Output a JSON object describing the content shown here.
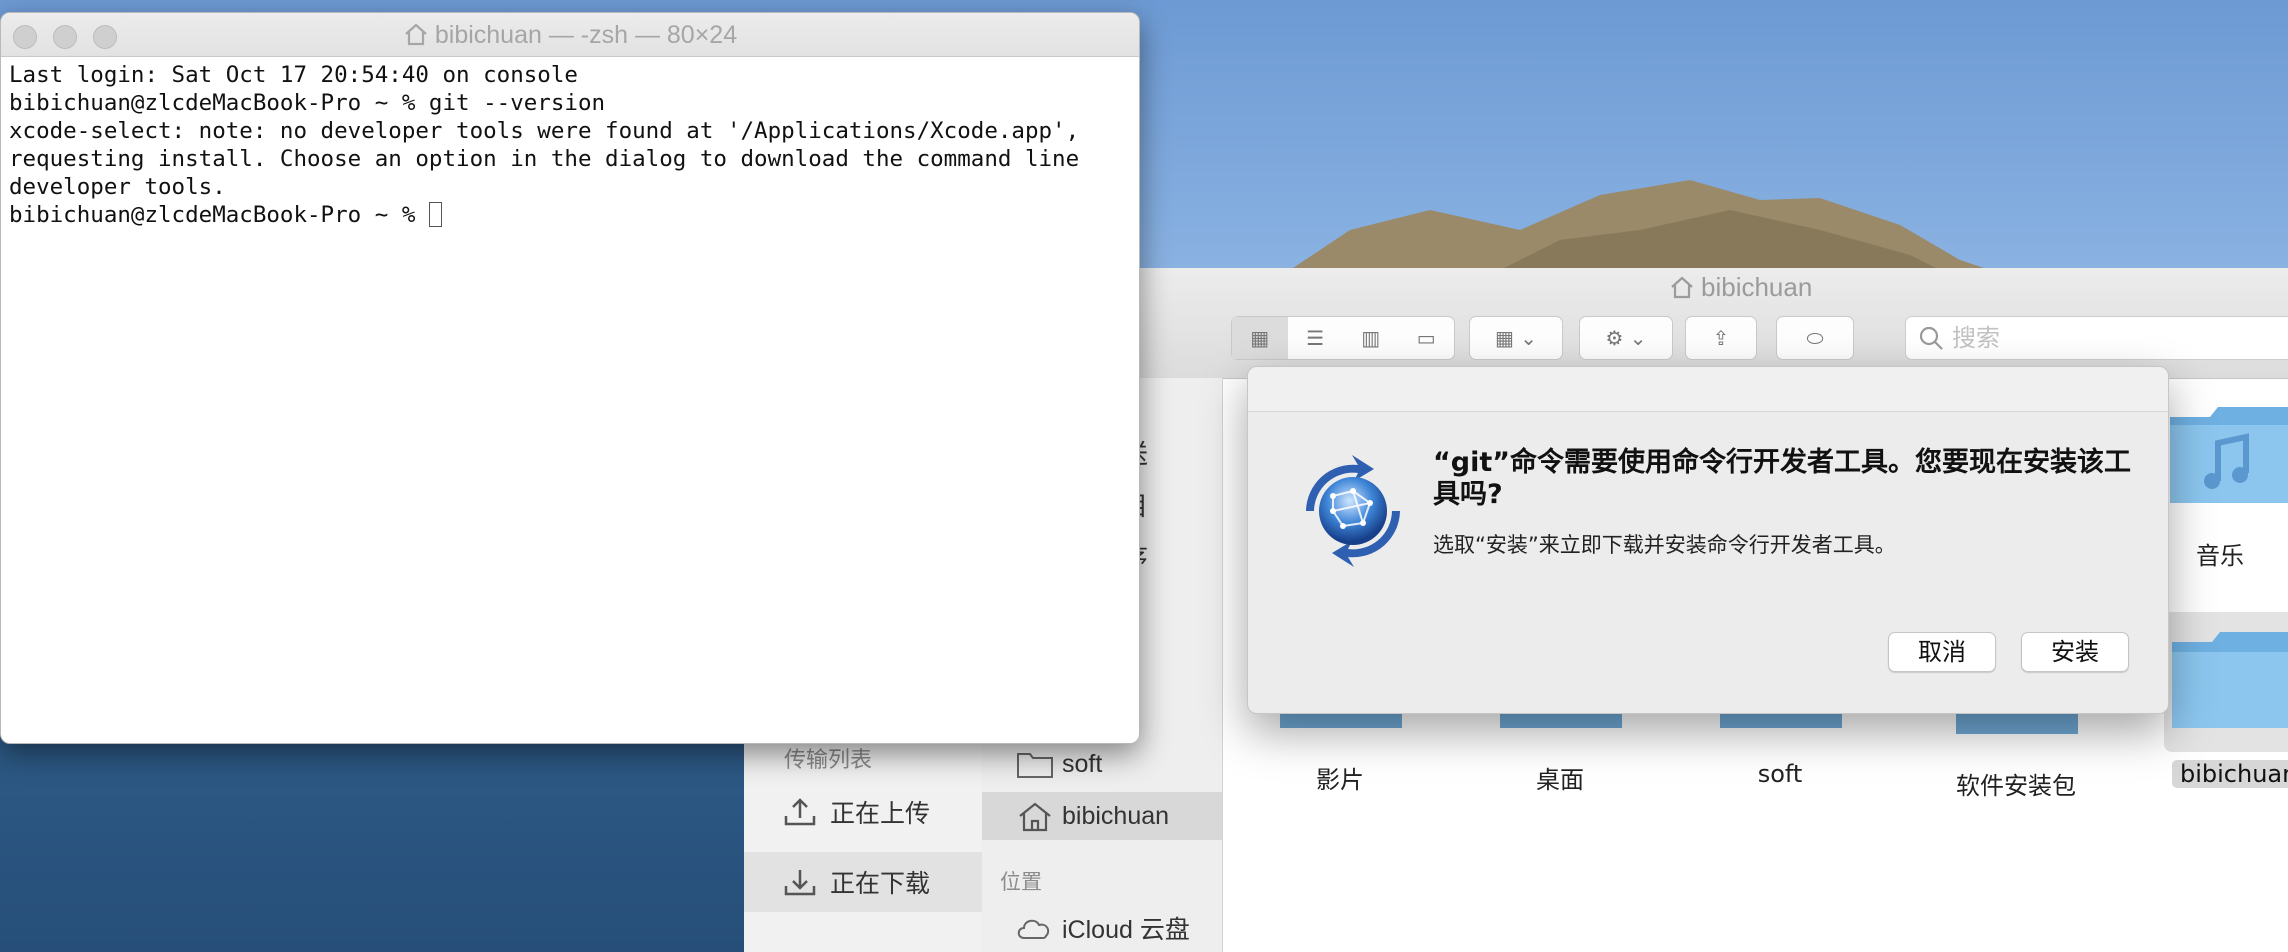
{
  "terminal": {
    "title": "bibichuan — -zsh — 80×24",
    "lines": [
      "Last login: Sat Oct 17 20:54:40 on console",
      "bibichuan@zlcdeMacBook-Pro ~ % git --version",
      "xcode-select: note: no developer tools were found at '/Applications/Xcode.app',",
      "requesting install. Choose an option in the dialog to download the command line",
      "developer tools."
    ],
    "prompt": "bibichuan@zlcdeMacBook-Pro ~ % "
  },
  "finder": {
    "title": "bibichuan",
    "search_placeholder": "搜索",
    "sidebar_fragments": [
      "送",
      "目",
      "序"
    ],
    "sidebar_items": [
      {
        "label": "soft",
        "icon": "folder-icon"
      },
      {
        "label": "bibichuan",
        "icon": "home-icon"
      }
    ],
    "locations_header": "位置",
    "icloud_label": "iCloud 云盘",
    "grid_items": [
      "影片",
      "桌面",
      "soft",
      "软件安装包",
      "bibichuan"
    ],
    "music_label": "音乐"
  },
  "baidu": {
    "header": "传输列表",
    "uploading": "正在上传",
    "downloading": "正在下载"
  },
  "dialog": {
    "title": "“git”命令需要使用命令行开发者工具。您要现在安装该工具吗?",
    "message": "选取“安装”来立即下载并安装命令行开发者工具。",
    "cancel_label": "取消",
    "install_label": "安装"
  }
}
